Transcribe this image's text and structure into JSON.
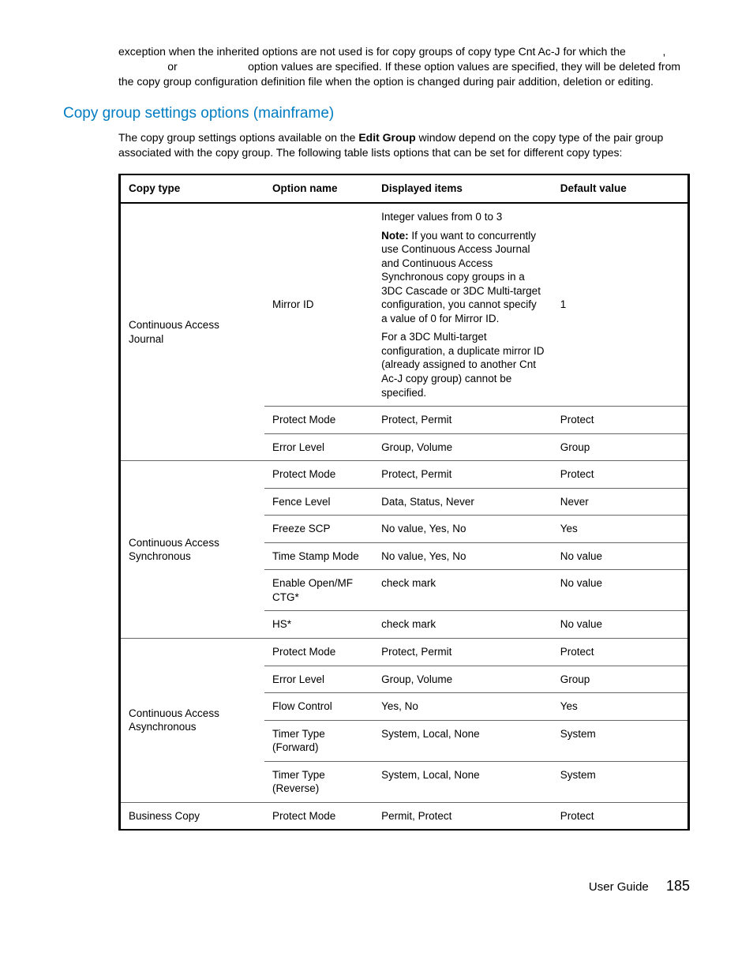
{
  "intro_paragraph": "exception when the inherited options are not used is for copy groups of copy type Cnt Ac-J for which the            ,                 or                       option values are specified. If these option values are specified, they will be deleted from the copy group configuration definition file when the option is changed during pair addition, deletion or editing.",
  "section_heading": "Copy group settings options (mainframe)",
  "section_intro_pre": "The copy group settings options available on the ",
  "section_intro_bold": "Edit Group",
  "section_intro_post": " window depend on the copy type of the pair group associated with the copy group. The following table lists options that can be set for different copy types:",
  "headers": {
    "copy_type": "Copy type",
    "option_name": "Option name",
    "displayed_items": "Displayed items",
    "default_value": "Default value"
  },
  "rows": {
    "caj": {
      "copy_type": "Continuous Access Journal",
      "mirror_id": {
        "option": "Mirror ID",
        "disp_p1": "Integer values from 0 to 3",
        "disp_p2_bold": "Note:",
        "disp_p2_rest": " If you want to concurrently use Continuous Access Journal and Continuous Access Synchronous copy groups in a 3DC Cascade or 3DC Multi-target configuration, you cannot specify a value of 0 for Mirror ID.",
        "disp_p3": "For a 3DC Multi-target configuration, a duplicate mirror ID (already assigned to another Cnt Ac-J copy group) cannot be specified.",
        "default": "1"
      },
      "protect_mode": {
        "option": "Protect Mode",
        "disp": "Protect, Permit",
        "default": "Protect"
      },
      "error_level": {
        "option": "Error Level",
        "disp": "Group, Volume",
        "default": "Group"
      }
    },
    "cas": {
      "copy_type": "Continuous Access Synchronous",
      "protect_mode": {
        "option": "Protect Mode",
        "disp": "Protect, Permit",
        "default": "Protect"
      },
      "fence_level": {
        "option": "Fence Level",
        "disp": "Data, Status, Never",
        "default": "Never"
      },
      "freeze_scp": {
        "option": "Freeze SCP",
        "disp": "No value, Yes, No",
        "default": "Yes"
      },
      "time_stamp": {
        "option": "Time Stamp Mode",
        "disp": "No value, Yes, No",
        "default": "No value"
      },
      "enable_open": {
        "option": "Enable Open/MF CTG*",
        "disp": "check mark",
        "default": "No value"
      },
      "hs": {
        "option": "HS*",
        "disp": "check mark",
        "default": "No value"
      }
    },
    "caa": {
      "copy_type": "Continuous Access Asynchronous",
      "protect_mode": {
        "option": "Protect Mode",
        "disp": "Protect, Permit",
        "default": "Protect"
      },
      "error_level": {
        "option": "Error Level",
        "disp": "Group, Volume",
        "default": "Group"
      },
      "flow_control": {
        "option": "Flow Control",
        "disp": "Yes, No",
        "default": "Yes"
      },
      "timer_fwd": {
        "option": "Timer Type (Forward)",
        "disp": "System, Local, None",
        "default": "System"
      },
      "timer_rev": {
        "option": "Timer Type (Reverse)",
        "disp": "System, Local, None",
        "default": "System"
      }
    },
    "bc": {
      "copy_type": "Business Copy",
      "protect_mode": {
        "option": "Protect Mode",
        "disp": "Permit, Protect",
        "default": "Protect"
      }
    }
  },
  "footer": {
    "label": "User Guide",
    "page": "185"
  }
}
